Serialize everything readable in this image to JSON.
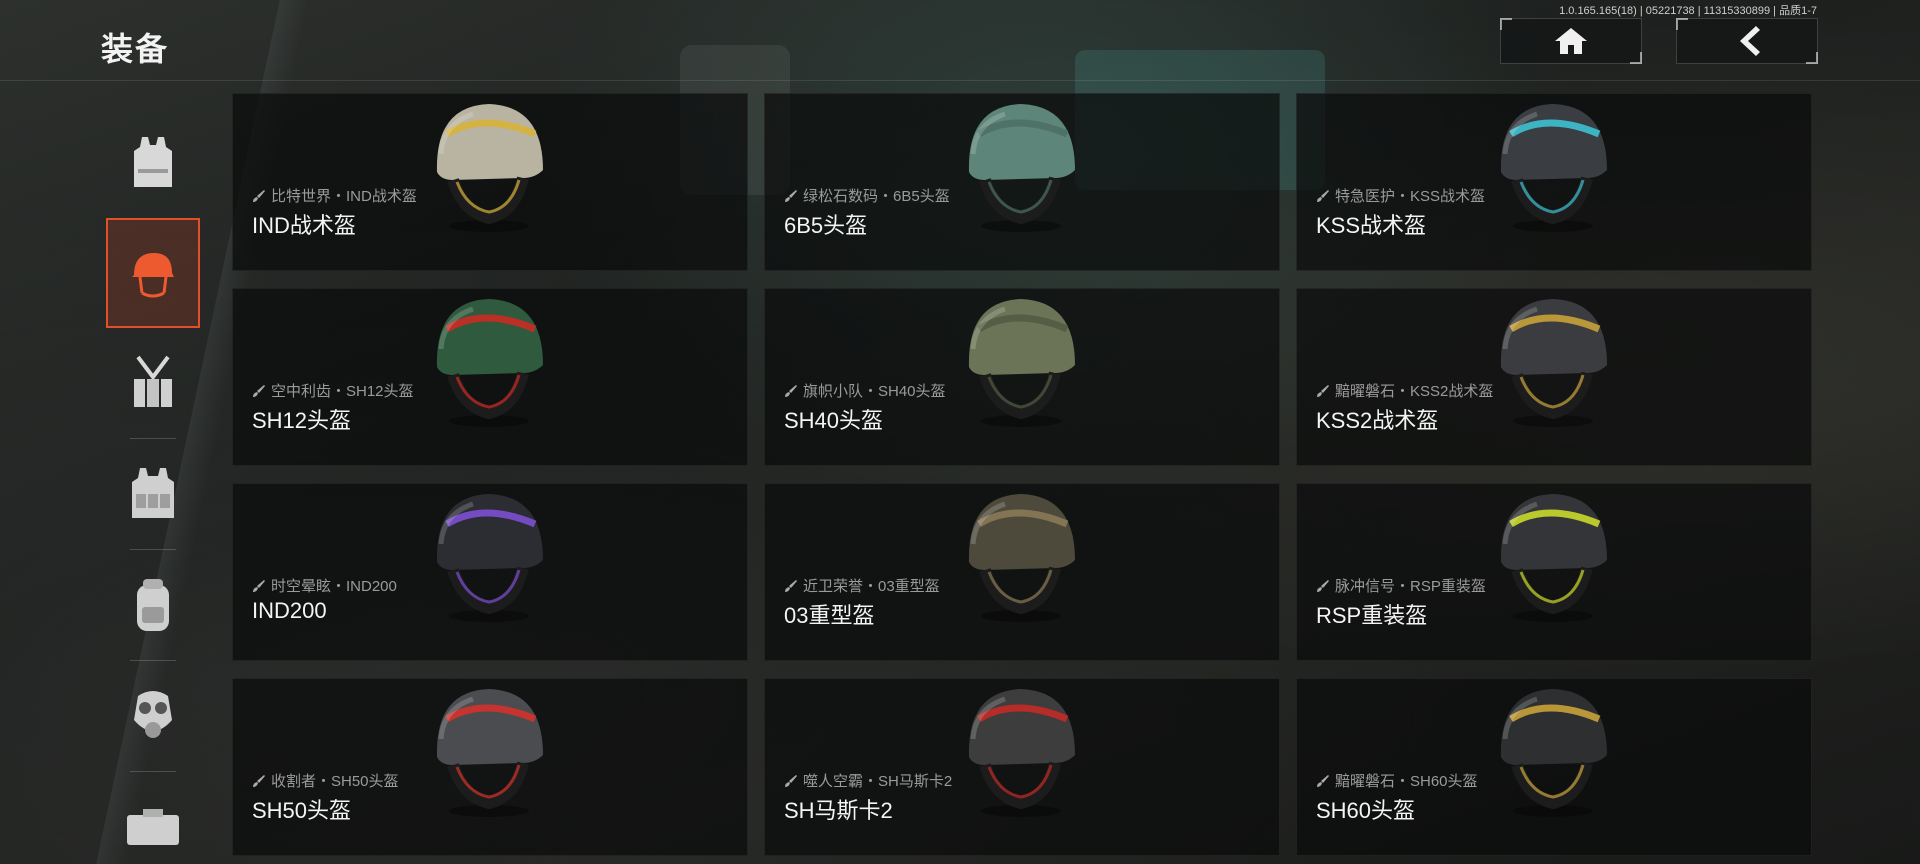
{
  "header": {
    "title": "装备",
    "build_info": "1.0.165.165(18) | 05221738 | 11315330899 | 品质1-7"
  },
  "sidebar": {
    "items": [
      {
        "icon": "armor-vest-icon",
        "active": false
      },
      {
        "icon": "helmet-icon",
        "active": true
      },
      {
        "icon": "chest-rig-icon",
        "active": false
      },
      {
        "icon": "tactical-vest-icon",
        "active": false
      },
      {
        "icon": "backpack-icon",
        "active": false
      },
      {
        "icon": "gas-mask-icon",
        "active": false
      },
      {
        "icon": "ammo-box-icon",
        "active": false
      }
    ]
  },
  "colors": {
    "accent": "#e0502a",
    "card_bg": "#0a0b0b"
  },
  "helmets": [
    {
      "skin": "比特世界・IND战术盔",
      "name": "IND战术盔",
      "color": "#b9b4a2",
      "accent": "#d7b23a"
    },
    {
      "skin": "绿松石数码・6B5头盔",
      "name": "6B5头盔",
      "color": "#5e8579",
      "accent": "#4c6f66"
    },
    {
      "skin": "特急医护・KSS战术盔",
      "name": "KSS战术盔",
      "color": "#3a3d42",
      "accent": "#3ec1d1"
    },
    {
      "skin": "空中利齿・SH12头盔",
      "name": "SH12头盔",
      "color": "#2f5a3d",
      "accent": "#cc2a22"
    },
    {
      "skin": "旗帜小队・SH40头盔",
      "name": "SH40头盔",
      "color": "#6b7456",
      "accent": "#535b43"
    },
    {
      "skin": "黯曜磐石・KSS2战术盔",
      "name": "KSS2战术盔",
      "color": "#3b3c40",
      "accent": "#c9a23a"
    },
    {
      "skin": "时空晕眩・IND200",
      "name": "IND200",
      "color": "#2b2d33",
      "accent": "#7c4fd1"
    },
    {
      "skin": "近卫荣誉・03重型盔",
      "name": "03重型盔",
      "color": "#4d4a3c",
      "accent": "#8a7a55"
    },
    {
      "skin": "脉冲信号・RSP重装盔",
      "name": "RSP重装盔",
      "color": "#333538",
      "accent": "#c9d92a"
    },
    {
      "skin": "收割者・SH50头盔",
      "name": "SH50头盔",
      "color": "#4a4c50",
      "accent": "#d3322a"
    },
    {
      "skin": "噬人空霸・SH马斯卡2",
      "name": "SH马斯卡2",
      "color": "#3d3d3d",
      "accent": "#c22a26"
    },
    {
      "skin": "黯曜磐石・SH60头盔",
      "name": "SH60头盔",
      "color": "#2e2f31",
      "accent": "#c9a23a"
    }
  ]
}
